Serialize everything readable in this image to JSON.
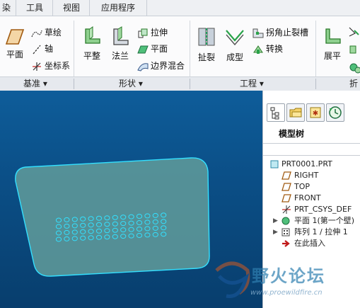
{
  "menu": {
    "tabs": [
      "染",
      "工具",
      "视图",
      "应用程序"
    ]
  },
  "ribbon": {
    "datum_group": {
      "plane_label": "平面",
      "sketch_label": "草绘",
      "axis_label": "轴",
      "csys_label": "坐标系",
      "group_label": "基准"
    },
    "shapes_group": {
      "flat_label": "平整",
      "flange_label": "法兰",
      "extrude_label": "拉伸",
      "planar_label": "平面",
      "blend_label": "边界混合",
      "group_label": "形状"
    },
    "engineering_group": {
      "rip_label": "扯裂",
      "form_label": "成型",
      "corner_relief_label": "拐角止裂槽",
      "convert_label": "转换",
      "group_label": "工程"
    },
    "bend_group": {
      "unbend_label": "展平",
      "group_label": "折"
    }
  },
  "panel": {
    "title": "模型树",
    "tree": [
      {
        "label": "PRT0001.PRT",
        "icon": "part-icon"
      },
      {
        "label": "RIGHT",
        "icon": "datum-plane-icon"
      },
      {
        "label": "TOP",
        "icon": "datum-plane-icon"
      },
      {
        "label": "FRONT",
        "icon": "datum-plane-icon"
      },
      {
        "label": "PRT_CSYS_DEF",
        "icon": "csys-icon"
      },
      {
        "label": "平面 1(第一个壁)",
        "icon": "flat-wall-icon"
      },
      {
        "label": "阵列 1 / 拉伸 1",
        "icon": "pattern-icon"
      },
      {
        "label": "在此插入",
        "icon": "insert-here-icon"
      }
    ]
  },
  "watermark": {
    "title": "野火论坛",
    "url": "www.proewildfire.cn"
  },
  "colors": {
    "viewport_top": "#0e5d9a",
    "viewport_bottom": "#083e6d",
    "part_fill": "#5f9a9a",
    "part_edge": "#33e0ff",
    "accent_green": "#2aa34a"
  }
}
